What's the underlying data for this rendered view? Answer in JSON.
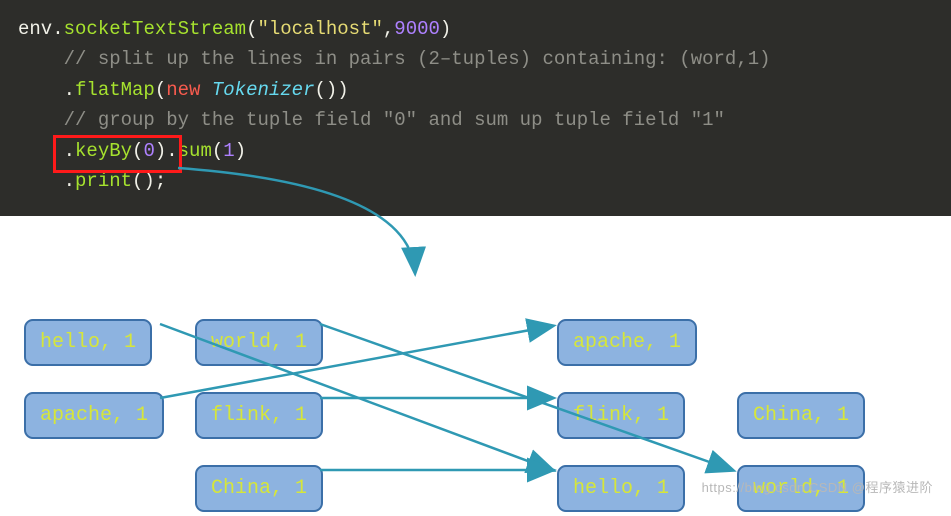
{
  "code": {
    "l1a": "env",
    "l1b": ".",
    "l1c": "socketTextStream",
    "l1d": "\"localhost\"",
    "l1e": ",",
    "l1f": "9000",
    "l1g": ")",
    "l2": "// split up the lines in pairs (2–tuples) containing: (word,1)",
    "l3a": ".",
    "l3b": "flatMap",
    "l3c": "(",
    "l3d": "new",
    "l3e": " Tokenizer",
    "l3f": "())",
    "l4": "// group by the tuple field \"0\" and sum up tuple field \"1\"",
    "l5a": ".",
    "l5b": "keyBy",
    "l5c": "(",
    "l5d": "0",
    "l5e": ")",
    "l5f": ".",
    "l5g": "sum",
    "l5h": "(",
    "l5i": "1",
    "l5j": ")",
    "l6a": ".",
    "l6b": "print",
    "l6c": "();"
  },
  "boxes": {
    "left_hello": "hello, 1",
    "left_world": "world, 1",
    "left_apache": "apache, 1",
    "left_flink": "flink, 1",
    "left_china": "China, 1",
    "right_apache": "apache, 1",
    "right_flink": "flink, 1",
    "right_china": "China, 1",
    "right_hello": "hello, 1",
    "right_world": "world, 1"
  },
  "watermark": "https://blog.csdn CSDN @程序猿进阶"
}
